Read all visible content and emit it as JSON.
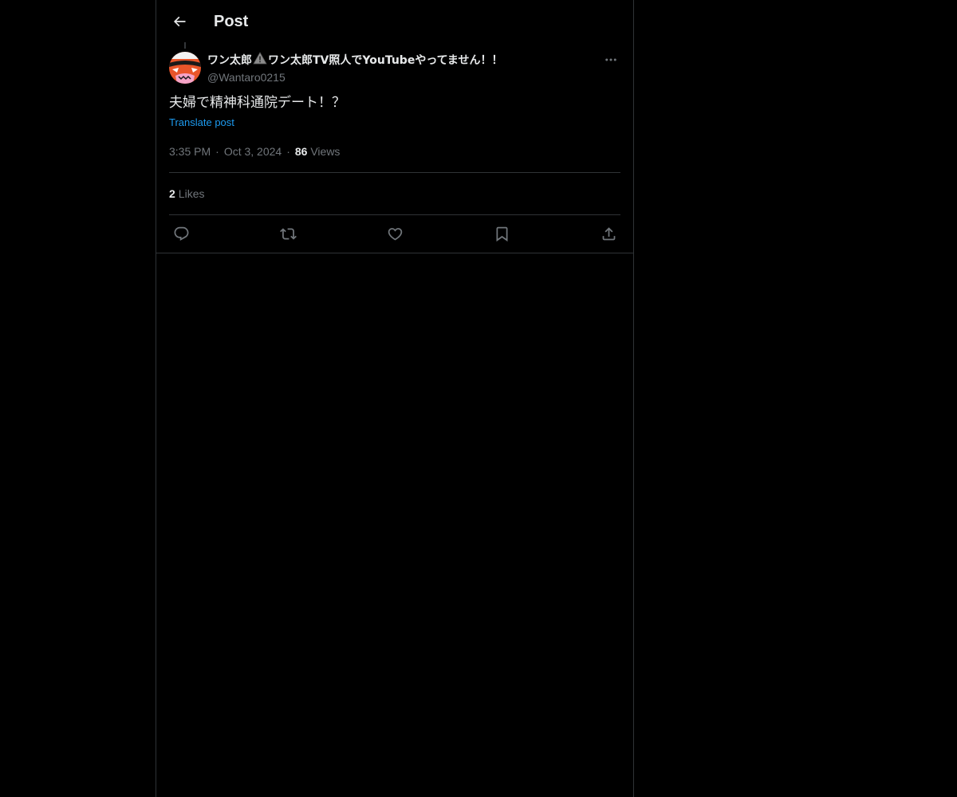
{
  "header": {
    "title": "Post",
    "back_icon": "arrow-left-icon"
  },
  "post": {
    "author": {
      "name_part1": "ワン太郎",
      "name_icon": "warning-icon",
      "name_part2": "ワン太郎TV照人でYouTubeやってません！！",
      "handle": "@Wantaro0215",
      "avatar_icon": "avatar-image"
    },
    "text": "夫婦で精神科通院デート！？",
    "translate_label": "Translate post",
    "time": "3:35 PM",
    "date": "Oct 3, 2024",
    "views_count": "86",
    "views_label": "Views",
    "likes_count": "2",
    "likes_label": "Likes"
  },
  "actions": {
    "reply": "reply-icon",
    "repost": "repost-icon",
    "like": "heart-icon",
    "bookmark": "bookmark-icon",
    "share": "share-icon",
    "more": "more-icon"
  },
  "colors": {
    "background": "#000000",
    "text": "#e7e9ea",
    "secondary": "#71767b",
    "link": "#1d9bf0",
    "border": "#2f3336"
  }
}
